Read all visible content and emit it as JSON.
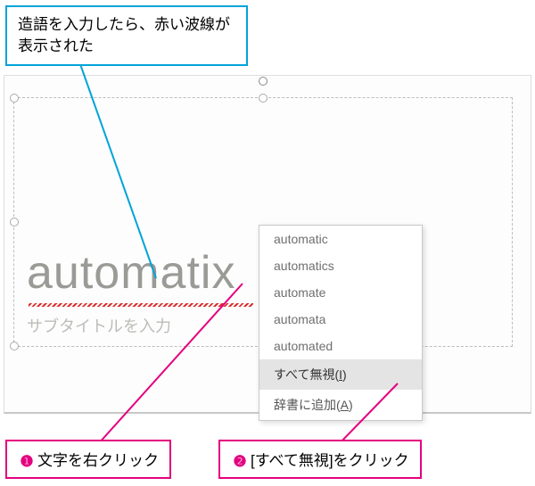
{
  "callout_top": "造語を入力したら、赤い波線が表示された",
  "slide": {
    "title": "automatix",
    "subtitle_placeholder": "サブタイトルを入力"
  },
  "menu": {
    "suggestions": [
      "automatic",
      "automatics",
      "automate",
      "automata",
      "automated"
    ],
    "ignore_all_prefix": "すべて無視(",
    "ignore_all_key": "I",
    "ignore_all_suffix": ")",
    "add_dict_prefix": "辞書に追加(",
    "add_dict_key": "A",
    "add_dict_suffix": ")"
  },
  "callouts": {
    "num1": "❶",
    "text1": "文字を右クリック",
    "num2": "❷",
    "text2": "[すべて無視]をクリック"
  }
}
